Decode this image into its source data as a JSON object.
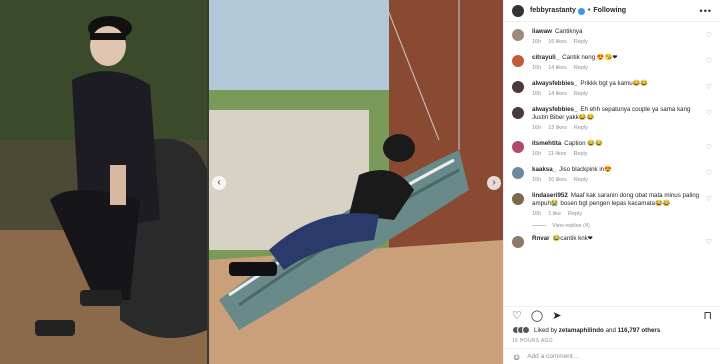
{
  "header": {
    "username": "febbyrastanty",
    "follow_label": "Following",
    "separator": "•",
    "more_icon": "more-icon"
  },
  "comments": [
    {
      "user": "liawaw",
      "text": "Cantiknya",
      "time": "16h",
      "likes": "16 likes",
      "reply": "Reply",
      "avatar_color": "#9a8b7a"
    },
    {
      "user": "citrayuli_",
      "text": "Cantik neng 😍😘❤",
      "time": "16h",
      "likes": "14 likes",
      "reply": "Reply",
      "avatar_color": "#c25a3a"
    },
    {
      "user": "alwaysfebbies_",
      "text": "Prikkk bgt ya kamu😂😂",
      "time": "16h",
      "likes": "14 likes",
      "reply": "Reply",
      "avatar_color": "#4a3a3a"
    },
    {
      "user": "alwaysfebbies_",
      "text": "Eh ehh sepatunya couple ya sama kang Justin Biber yakk😂😂",
      "time": "16h",
      "likes": "13 likes",
      "reply": "Reply",
      "avatar_color": "#4a3a3a"
    },
    {
      "user": "itsmehtita",
      "text": "Caption 😂😂",
      "time": "16h",
      "likes": "11 likes",
      "reply": "Reply",
      "avatar_color": "#b04a6a"
    },
    {
      "user": "kaaksa_",
      "text": "Jiso blackpink in😍",
      "time": "16h",
      "likes": "10 likes",
      "reply": "Reply",
      "avatar_color": "#6a8aa0"
    },
    {
      "user": "lindaseri952",
      "text": "Maaf kak saranin dong obat mata minus paling ampuh😭 bosen bgt pengen lepas kacamata😂😂",
      "time": "16h",
      "likes": "1 like",
      "reply": "Reply",
      "avatar_color": "#7a6a4a"
    },
    {
      "user": "Rnvar",
      "text": "😂cantik knk❤",
      "time": "",
      "likes": "",
      "reply": "",
      "avatar_color": "#8a7a6a"
    }
  ],
  "view_replies": "View replies (4)",
  "liked_by": {
    "prefix": "Liked by",
    "user": "zetamaphilindo",
    "and": "and",
    "count": "116,797 others"
  },
  "time_ago": "16 HOURS AGO",
  "add_comment": "Add a comment…",
  "icons": [
    "heart-icon",
    "comment-icon",
    "share-icon",
    "bookmark-icon",
    "emoji-icon",
    "arrow-left-icon",
    "arrow-right-icon",
    "verified-icon"
  ]
}
